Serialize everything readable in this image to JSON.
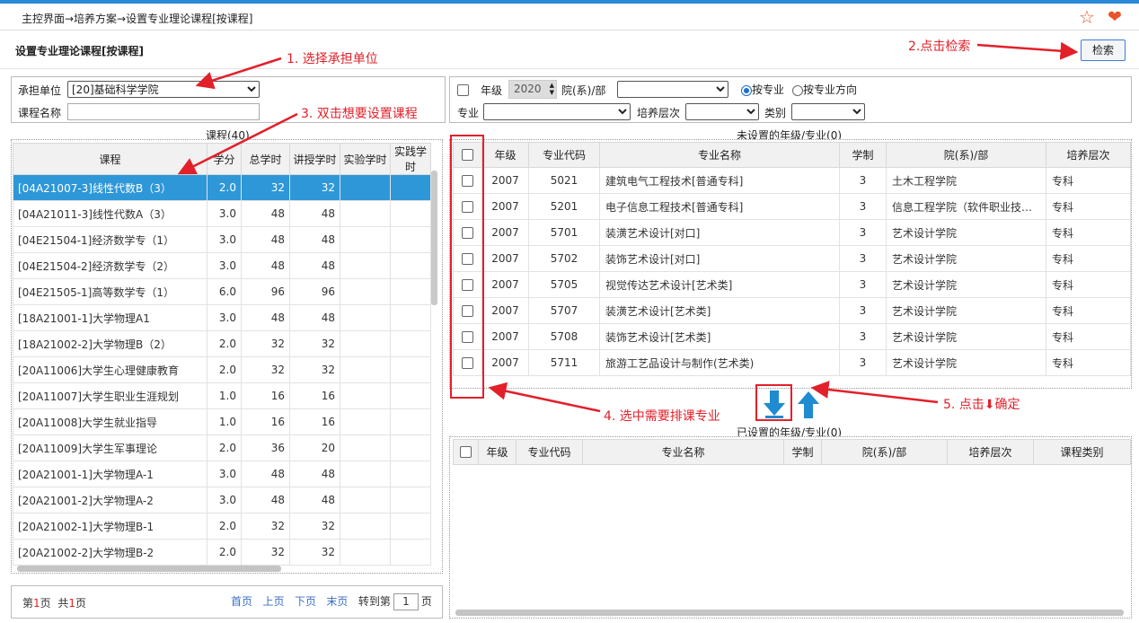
{
  "breadcrumb": "主控界面→培养方案→设置专业理论课程[按课程]",
  "page_title": "设置专业理论课程[按课程]",
  "search_button": "检索",
  "left_filter": {
    "unit_label": "承担单位",
    "unit_value": "[20]基础科学学院",
    "course_name_label": "课程名称",
    "course_name_value": ""
  },
  "right_filter": {
    "grade_label": "年级",
    "grade_value": "2020",
    "dept_label": "院(系)/部",
    "radio_major": "按专业",
    "radio_direction": "按专业方向",
    "major_label": "专业",
    "level_label": "培养层次",
    "category_label": "类别"
  },
  "course_table": {
    "caption": "课程(40)",
    "headers": [
      "课程",
      "学分",
      "总学时",
      "讲授学时",
      "实验学时",
      "实践学时"
    ],
    "rows": [
      [
        "[04A21007-3]线性代数B（3）",
        "2.0",
        "32",
        "32",
        "",
        ""
      ],
      [
        "[04A21011-3]线性代数A（3）",
        "3.0",
        "48",
        "48",
        "",
        ""
      ],
      [
        "[04E21504-1]经济数学专（1）",
        "3.0",
        "48",
        "48",
        "",
        ""
      ],
      [
        "[04E21504-2]经济数学专（2）",
        "3.0",
        "48",
        "48",
        "",
        ""
      ],
      [
        "[04E21505-1]高等数学专（1）",
        "6.0",
        "96",
        "96",
        "",
        ""
      ],
      [
        "[18A21001-1]大学物理A1",
        "3.0",
        "48",
        "48",
        "",
        ""
      ],
      [
        "[18A21002-2]大学物理B（2）",
        "2.0",
        "32",
        "32",
        "",
        ""
      ],
      [
        "[20A11006]大学生心理健康教育",
        "2.0",
        "32",
        "32",
        "",
        ""
      ],
      [
        "[20A11007]大学生职业生涯规划",
        "1.0",
        "16",
        "16",
        "",
        ""
      ],
      [
        "[20A11008]大学生就业指导",
        "1.0",
        "16",
        "16",
        "",
        ""
      ],
      [
        "[20A11009]大学生军事理论",
        "2.0",
        "36",
        "20",
        "",
        ""
      ],
      [
        "[20A21001-1]大学物理A-1",
        "3.0",
        "48",
        "48",
        "",
        ""
      ],
      [
        "[20A21001-2]大学物理A-2",
        "3.0",
        "48",
        "48",
        "",
        ""
      ],
      [
        "[20A21002-1]大学物理B-1",
        "2.0",
        "32",
        "32",
        "",
        ""
      ],
      [
        "[20A21002-2]大学物理B-2",
        "2.0",
        "32",
        "32",
        "",
        ""
      ]
    ],
    "selected_index": 0
  },
  "pager": {
    "p1": "第",
    "current": "1",
    "p2": "页",
    "p3": "共",
    "total": "1",
    "p4": "页",
    "first": "首页",
    "prev": "上页",
    "next": "下页",
    "last": "末页",
    "goto": "转到第",
    "goto_value": "1",
    "goto_suffix": "页"
  },
  "unset_table": {
    "caption": "未设置的年级/专业(0)",
    "headers": [
      "年级",
      "专业代码",
      "专业名称",
      "学制",
      "院(系)/部",
      "培养层次"
    ],
    "rows": [
      [
        "2007",
        "5021",
        "建筑电气工程技术[普通专科]",
        "3",
        "土木工程学院",
        "专科"
      ],
      [
        "2007",
        "5201",
        "电子信息工程技术[普通专科]",
        "3",
        "信息工程学院（软件职业技…",
        "专科"
      ],
      [
        "2007",
        "5701",
        "装潢艺术设计[对口]",
        "3",
        "艺术设计学院",
        "专科"
      ],
      [
        "2007",
        "5702",
        "装饰艺术设计[对口]",
        "3",
        "艺术设计学院",
        "专科"
      ],
      [
        "2007",
        "5705",
        "视觉传达艺术设计[艺术类]",
        "3",
        "艺术设计学院",
        "专科"
      ],
      [
        "2007",
        "5707",
        "装潢艺术设计[艺术类]",
        "3",
        "艺术设计学院",
        "专科"
      ],
      [
        "2007",
        "5708",
        "装饰艺术设计[艺术类]",
        "3",
        "艺术设计学院",
        "专科"
      ],
      [
        "2007",
        "5711",
        "旅游工艺品设计与制作(艺术类)",
        "3",
        "艺术设计学院",
        "专科"
      ]
    ]
  },
  "set_table": {
    "caption": "已设置的年级/专业(0)",
    "headers": [
      "年级",
      "专业代码",
      "专业名称",
      "学制",
      "院(系)/部",
      "培养层次",
      "课程类别"
    ]
  },
  "annotations": {
    "a1": "1. 选择承担单位",
    "a2": "2.点击检索",
    "a3": "3. 双击想要设置课程",
    "a4": "4. 选中需要排课专业",
    "a5": "5. 点击⬇确定"
  },
  "colors": {
    "accent": "#2e97d8",
    "annotation": "#e2202a",
    "arrow_button": "#1f8bd0"
  }
}
